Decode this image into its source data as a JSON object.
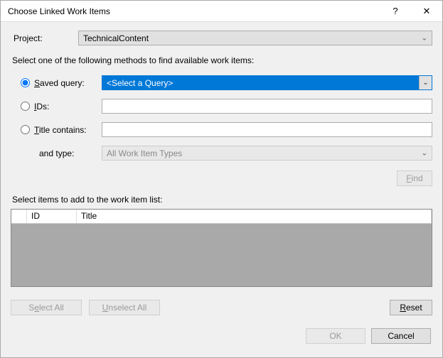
{
  "titlebar": {
    "title": "Choose Linked Work Items",
    "help": "?",
    "close": "✕"
  },
  "project": {
    "label": "Project:",
    "value": "TechnicalContent"
  },
  "instruction": "Select one of the following methods to find available work items:",
  "methods": {
    "saved_query": {
      "label_pre": "S",
      "label_post": "aved query:",
      "value": "<Select a Query>"
    },
    "ids": {
      "label_pre": "I",
      "label_post": "Ds:",
      "value": ""
    },
    "title": {
      "label_pre": "T",
      "label_post": "itle contains:",
      "value": ""
    },
    "and_type": {
      "label": "and type:",
      "value": "All Work Item Types"
    }
  },
  "find": {
    "label_pre": "F",
    "label_post": "ind"
  },
  "list": {
    "label": "Select items to add to the work item list:",
    "columns": {
      "id": "ID",
      "title": "Title"
    },
    "rows": []
  },
  "buttons": {
    "select_all": {
      "pre": "S",
      "mid": "e",
      "post": "lect All"
    },
    "unselect_all": {
      "pre": "U",
      "post": "nselect All"
    },
    "reset": {
      "pre": "R",
      "post": "eset"
    },
    "ok": "OK",
    "cancel": "Cancel"
  }
}
